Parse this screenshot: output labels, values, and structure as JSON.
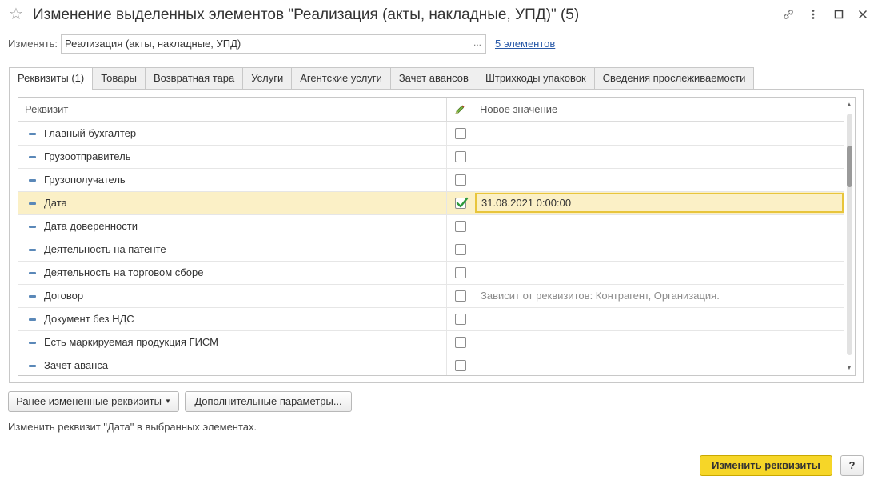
{
  "window": {
    "title": "Изменение выделенных элементов \"Реализация (акты, накладные, УПД)\" (5)"
  },
  "change": {
    "label": "Изменять:",
    "value": "Реализация (акты, накладные, УПД)",
    "choose_label": "...",
    "elements_link": "5 элементов"
  },
  "tabs": [
    {
      "label": "Реквизиты (1)",
      "active": true
    },
    {
      "label": "Товары"
    },
    {
      "label": "Возвратная тара"
    },
    {
      "label": "Услуги"
    },
    {
      "label": "Агентские услуги"
    },
    {
      "label": "Зачет авансов"
    },
    {
      "label": "Штрихкоды упаковок"
    },
    {
      "label": "Сведения прослеживаемости"
    }
  ],
  "grid": {
    "col_name": "Реквизит",
    "col_value": "Новое значение",
    "rows": [
      {
        "name": "Главный бухгалтер",
        "checked": false,
        "value": ""
      },
      {
        "name": "Грузоотправитель",
        "checked": false,
        "value": ""
      },
      {
        "name": "Грузополучатель",
        "checked": false,
        "value": ""
      },
      {
        "name": "Дата",
        "checked": true,
        "value": "31.08.2021 0:00:00"
      },
      {
        "name": "Дата доверенности",
        "checked": false,
        "value": ""
      },
      {
        "name": "Деятельность на патенте",
        "checked": false,
        "value": ""
      },
      {
        "name": "Деятельность на торговом сборе",
        "checked": false,
        "value": ""
      },
      {
        "name": "Договор",
        "checked": false,
        "value": "",
        "hint": "Зависит от реквизитов: Контрагент, Организация."
      },
      {
        "name": "Документ без НДС",
        "checked": false,
        "value": ""
      },
      {
        "name": "Есть маркируемая продукция ГИСМ",
        "checked": false,
        "value": ""
      },
      {
        "name": "Зачет аванса",
        "checked": false,
        "value": ""
      }
    ]
  },
  "buttons": {
    "prev_changed": "Ранее измененные реквизиты",
    "more_params": "Дополнительные параметры...",
    "apply": "Изменить реквизиты",
    "help": "?"
  },
  "status_text": "Изменить реквизит \"Дата\" в выбранных элементах.",
  "colors": {
    "accent_yellow": "#f6d628",
    "selected_row": "#fbf0c6",
    "link": "#2a5aa8",
    "check_green": "#2e9a3c"
  }
}
